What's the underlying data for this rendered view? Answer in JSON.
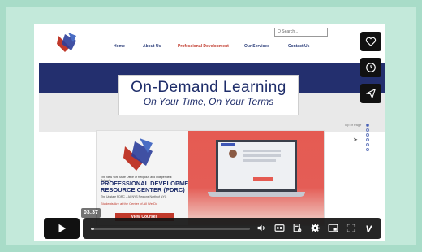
{
  "site": {
    "nav": [
      "Home",
      "About Us",
      "Professional Development",
      "Our Services",
      "Contact Us"
    ],
    "search_placeholder": "Q Search..."
  },
  "hero": {
    "title": "On-Demand Learning",
    "subtitle": "On Your Time, On Your Terms"
  },
  "page_nav": {
    "top_of_page": "Top of Page"
  },
  "pdrc": {
    "small_text": "The New York State Office of Religious and Independent Schools",
    "title_line1": "PROFESSIONAL DEVELOPMENT",
    "title_line2": "RESOURCE CENTER (PDRC)",
    "description": "The Upstate PDRC – All NYS Regions North of NYC",
    "tagline": "Students Are at the Center of All We Do",
    "button": "View Courses"
  },
  "player": {
    "timecode": "03:37",
    "progress_fraction": 0.02,
    "icons": [
      "heart-icon",
      "clock-icon",
      "send-icon",
      "play-icon",
      "volume-icon",
      "captions-icon",
      "transcript-icon",
      "settings-icon",
      "pip-icon",
      "fullscreen-icon",
      "vimeo-logo"
    ],
    "vimeo": "v"
  },
  "colors": {
    "navy": "#232f6e",
    "accent_red": "#c0392b",
    "background": "#a8dcc8"
  }
}
